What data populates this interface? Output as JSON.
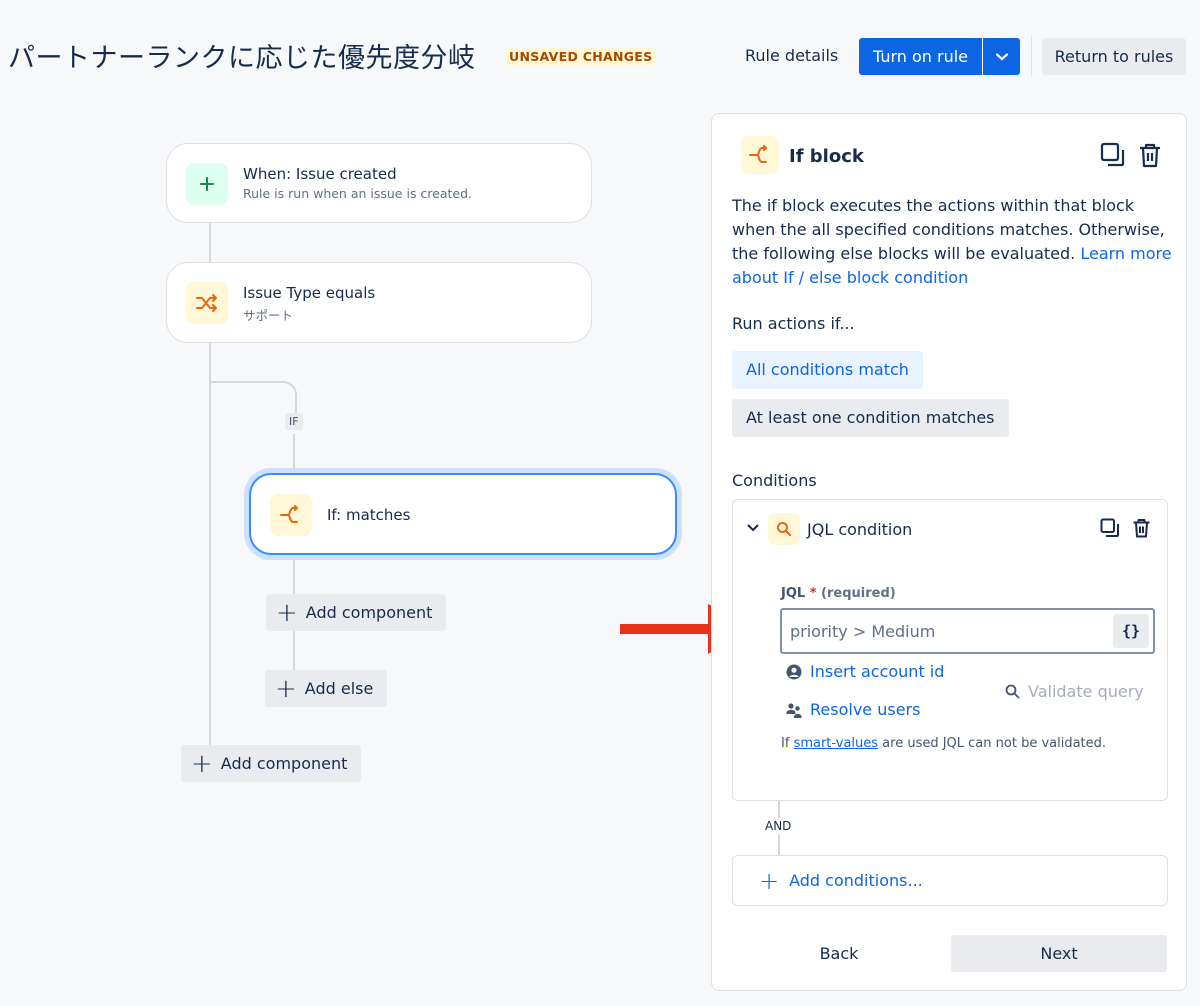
{
  "header": {
    "title": "パートナーランクに応じた優先度分岐",
    "badge": "UNSAVED CHANGES",
    "rule_details": "Rule details",
    "turn_on": "Turn on rule",
    "return": "Return to rules"
  },
  "flow": {
    "trigger": {
      "title": "When: Issue created",
      "subtitle": "Rule is run when an issue is created.",
      "icon": "plus-icon"
    },
    "condition": {
      "title": "Issue Type equals",
      "subtitle": "サポート",
      "icon": "shuffle-icon"
    },
    "if_chip": "IF",
    "if_block": {
      "title": "If: matches",
      "icon": "branch-icon"
    },
    "add_component_inner": "Add component",
    "add_else": "Add else",
    "add_component_outer": "Add component"
  },
  "panel": {
    "title": "If block",
    "description_text": "The if block executes the actions within that block when the all specified conditions matches. Otherwise, the following else blocks will be evaluated.",
    "description_link": "Learn more about If / else block condition",
    "run_label": "Run actions if...",
    "option_all": "All conditions match",
    "option_one": "At least one condition matches",
    "conditions_label": "Conditions",
    "condition_card": {
      "title": "JQL condition",
      "jql_label": "JQL",
      "required_text": "(required)",
      "jql_value": "priority > Medium",
      "braces": "{}",
      "insert_account": "Insert account id",
      "resolve_users": "Resolve users",
      "validate": "Validate query",
      "help_prefix": "If",
      "help_link": "smart-values",
      "help_suffix": "are used JQL can not be validated."
    },
    "and_label": "AND",
    "add_conditions": "Add conditions...",
    "back": "Back",
    "next": "Next"
  },
  "colors": {
    "primary": "#0c66e4",
    "arrow": "#e8321c",
    "badge_text": "#a54800",
    "badge_bg": "#fff7d6"
  }
}
